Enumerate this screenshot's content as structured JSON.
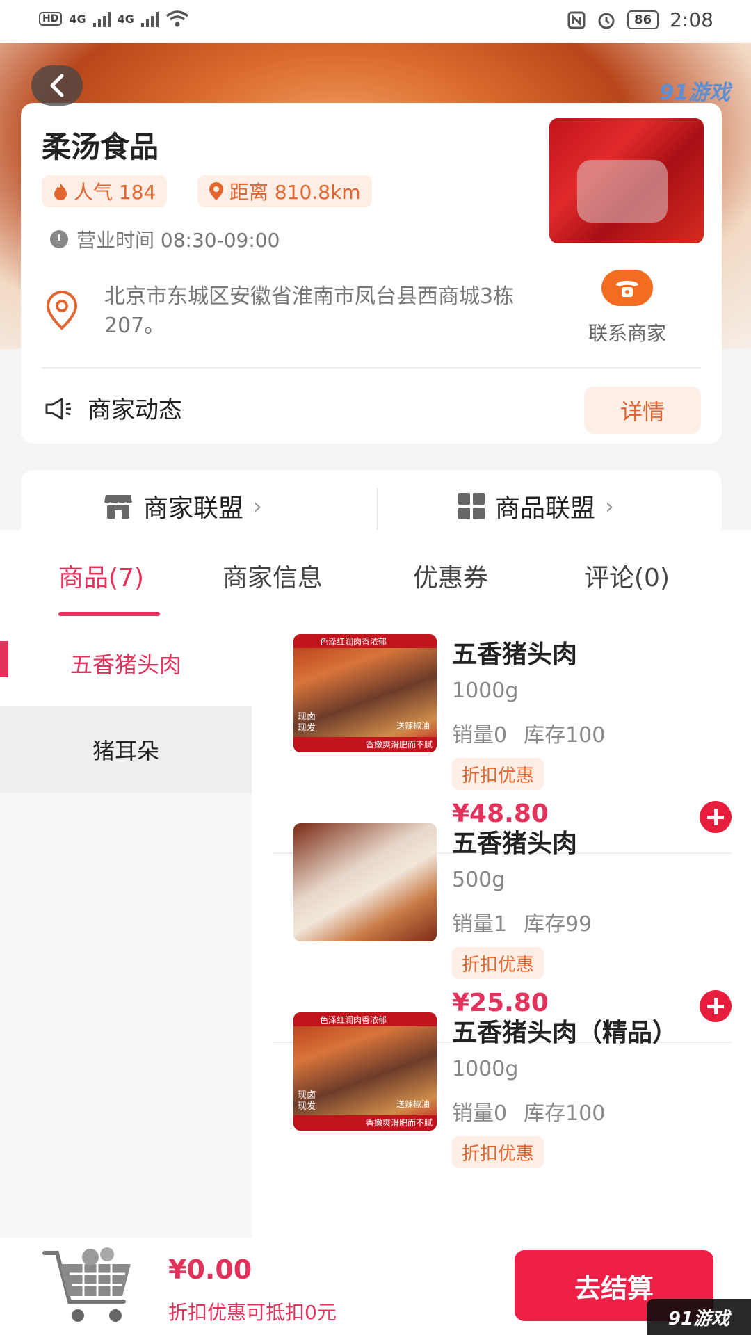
{
  "status_bar": {
    "left_badge": "HD",
    "signal_label_1": "4G",
    "signal_label_2": "4G",
    "battery": "86",
    "time": "2:08"
  },
  "watermark": {
    "top": "91游戏",
    "bottom": "91游戏"
  },
  "store": {
    "name": "柔汤食品",
    "popularity_label": "人气 184",
    "distance_label": "距离 810.8km",
    "hours_label": "营业时间 08:30-09:00",
    "address": "北京市东城区安徽省淮南市凤台县西商城3栋207。",
    "contact_label": "联系商家",
    "news_label": "商家动态",
    "detail_button": "详情"
  },
  "alliance": {
    "merchant": "商家联盟",
    "product": "商品联盟"
  },
  "tabs": [
    {
      "label": "商品(7)"
    },
    {
      "label": "商家信息"
    },
    {
      "label": "优惠券"
    },
    {
      "label": "评论(0)"
    }
  ],
  "categories": [
    {
      "label": "五香猪头肉"
    },
    {
      "label": "猪耳朵"
    }
  ],
  "products": [
    {
      "name": "五香猪头肉",
      "spec": "1000g",
      "sales": "销量0",
      "stock": "库存100",
      "badge": "折扣优惠",
      "price": "¥48.80",
      "image_tag_top": "色泽红润肉香浓郁",
      "image_tag_side": "送辣椒油",
      "image_tag_bottom": "香嫩爽滑肥而不腻",
      "image_tag_corner": "现卤现发"
    },
    {
      "name": "五香猪头肉",
      "spec": "500g",
      "sales": "销量1",
      "stock": "库存99",
      "badge": "折扣优惠",
      "price": "¥25.80"
    },
    {
      "name": "五香猪头肉（精品）",
      "spec": "1000g",
      "sales": "销量0",
      "stock": "库存100",
      "badge": "折扣优惠",
      "image_tag_top": "色泽红润肉香浓郁",
      "image_tag_side": "送辣椒油",
      "image_tag_bottom": "香嫩爽滑肥而不腻",
      "image_tag_corner": "现卤现发"
    }
  ],
  "cart": {
    "total": "¥0.00",
    "discount_note": "折扣优惠可抵扣0元",
    "checkout_button": "去结算"
  },
  "colors": {
    "accent": "#e2315a",
    "orange": "#e0652f",
    "checkout": "#ef2048"
  },
  "icons": [
    "back-icon",
    "fire-icon",
    "location-icon",
    "clock-icon",
    "pin-icon",
    "phone-icon",
    "megaphone-icon",
    "store-icon",
    "grid-icon",
    "chevron-right-icon",
    "add-icon",
    "cart-icon"
  ]
}
